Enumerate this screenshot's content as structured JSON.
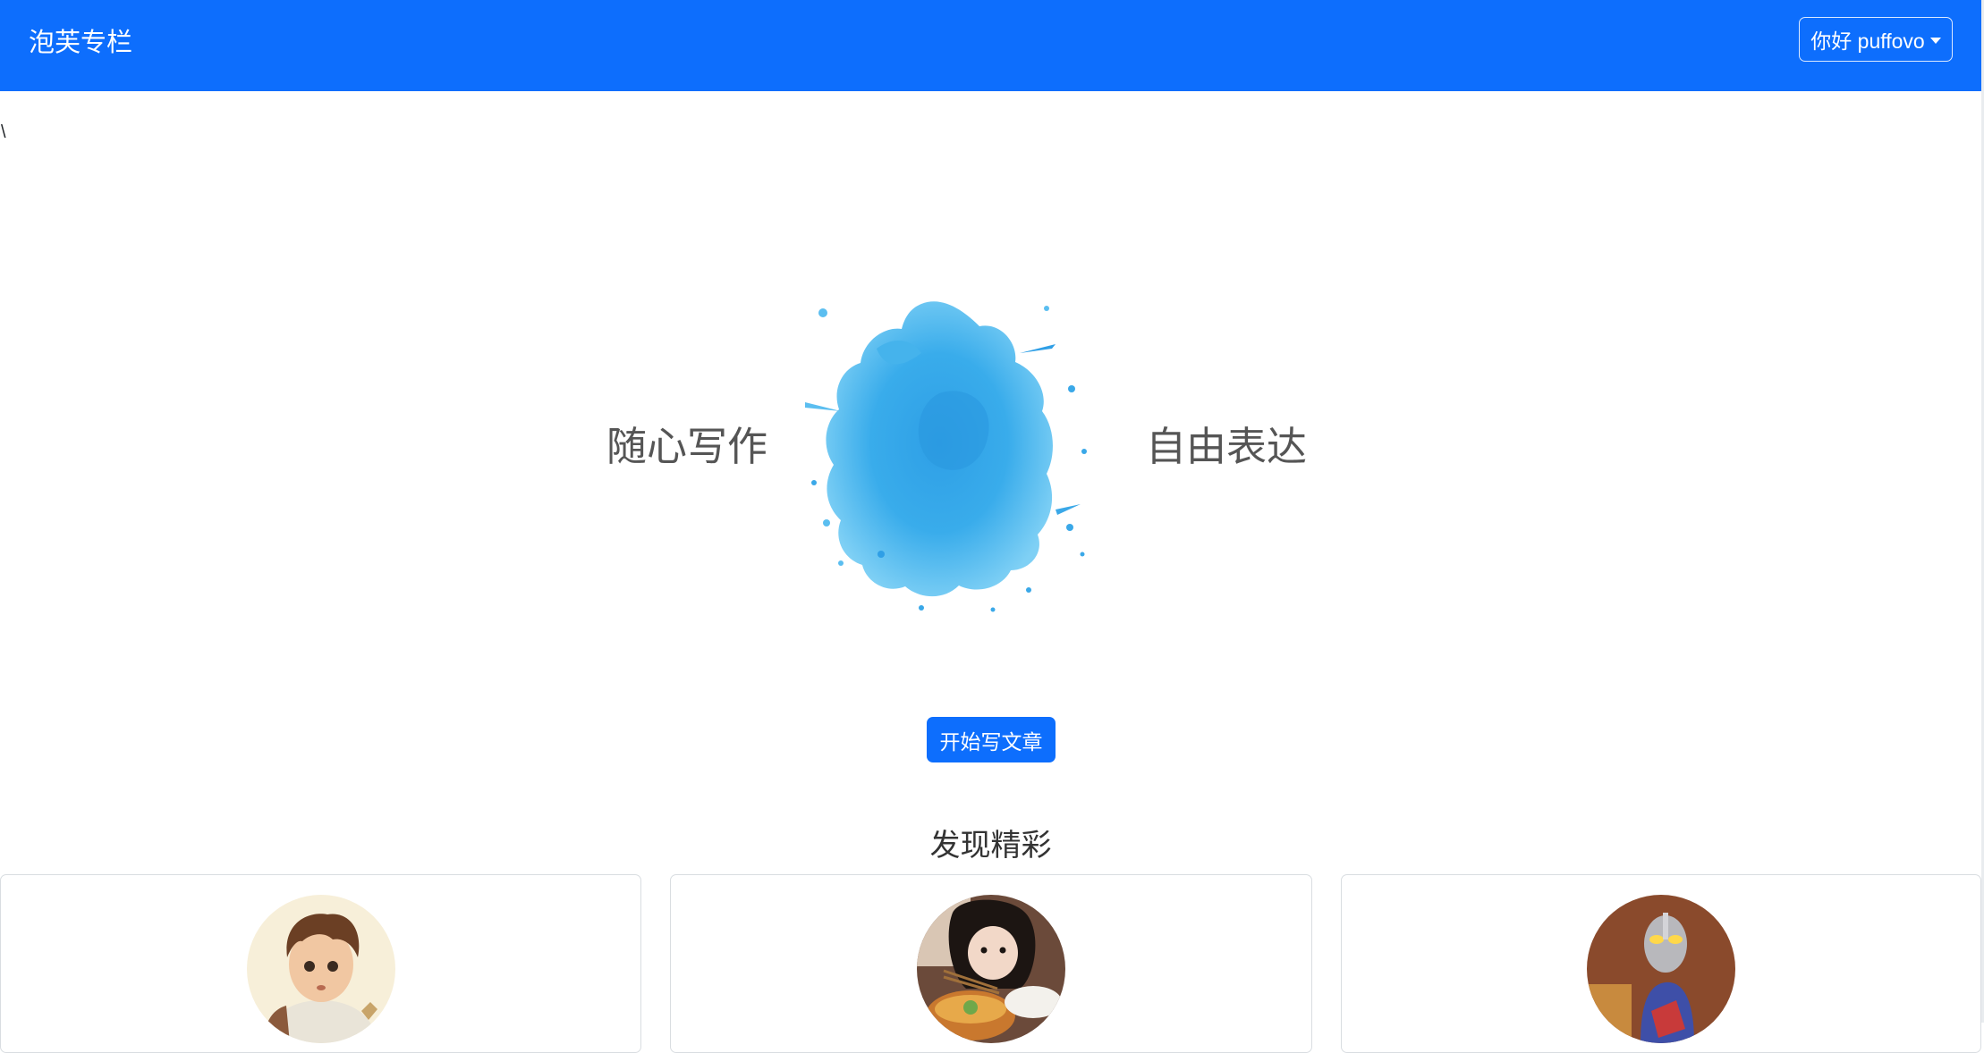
{
  "navbar": {
    "brand": "泡芙专栏",
    "user_menu_label": "你好 puffovo",
    "background_color": "#0d6efd"
  },
  "stray_text": "\\",
  "hero": {
    "left_text": "随心写作",
    "right_text": "自由表达",
    "splash_color": "#36a8e8"
  },
  "cta": {
    "label": "开始写文章"
  },
  "discover": {
    "title": "发现精彩",
    "cards": [
      {
        "avatar": "cartoon-boy-avatar"
      },
      {
        "avatar": "girl-eating-noodles-avatar"
      },
      {
        "avatar": "ultraman-figure-avatar"
      }
    ]
  }
}
